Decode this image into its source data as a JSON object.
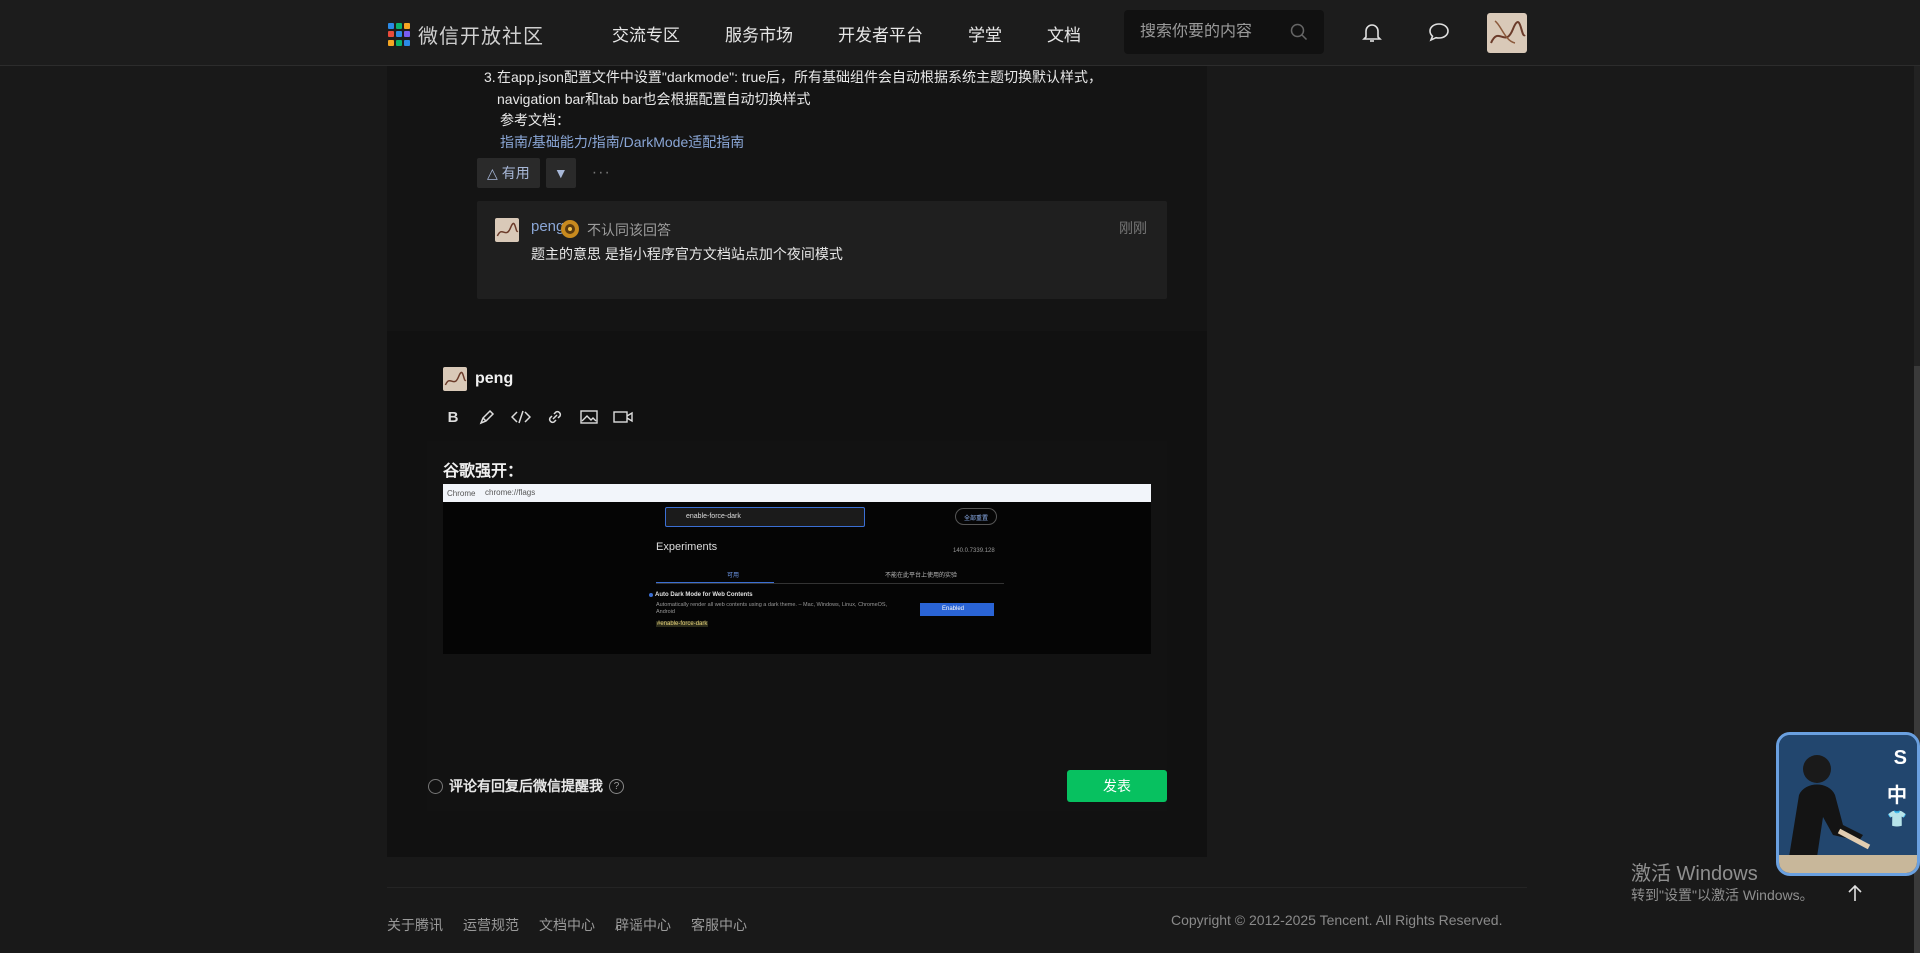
{
  "header": {
    "logo_text": "微信开放社区",
    "nav": [
      "交流专区",
      "服务市场",
      "开发者平台",
      "学堂",
      "文档"
    ],
    "search_placeholder": "搜索你要的内容"
  },
  "answer": {
    "item_number": "3.",
    "item_text": "在app.json配置文件中设置\"darkmode\": true后，所有基础组件会自动根据系统主题切换默认样式，navigation bar和tab bar也会根据配置自动切换样式",
    "ref_label": "参考文档：",
    "ref_link": "指南/基础能力/指南/DarkMode适配指南",
    "useful_label": "有用"
  },
  "comment": {
    "user": "peng",
    "disagree": "不认同该回答",
    "time": "刚刚",
    "text": "题主的意思  是指小程序官方文档站点加个夜间模式"
  },
  "editor": {
    "user": "peng",
    "content_text": "谷歌强开：",
    "screenshot": {
      "tab_label": "Chrome",
      "url": "chrome://flags",
      "search_value": "enable-force-dark",
      "reset_label": "全部重置",
      "title": "Experiments",
      "version": "140.0.7339.128",
      "tab_available": "可用",
      "tab_unavailable": "不能在此平台上使用的实验",
      "flag_name": "Auto Dark Mode for Web Contents",
      "flag_desc": "Automatically render all web contents using a dark theme. – Mac, Windows, Linux, ChromeOS, Android",
      "flag_tag": "#enable-force-dark",
      "select_value": "Enabled"
    },
    "remind_label": "评论有回复后微信提醒我",
    "publish_label": "发表"
  },
  "footer": {
    "links": [
      "关于腾讯",
      "运营规范",
      "文档中心",
      "辟谣中心",
      "客服中心"
    ],
    "copyright": "Copyright © 2012-2025 Tencent. All Rights Reserved."
  },
  "watermark": {
    "line1": "激活 Windows",
    "line2": "转到\"设置\"以激活 Windows。"
  },
  "widget": {
    "letters": [
      "S",
      "中",
      "👕"
    ]
  },
  "colors": {
    "background": "#191919",
    "card": "#111111",
    "link": "#8aa6d6",
    "publish": "#07c160"
  }
}
